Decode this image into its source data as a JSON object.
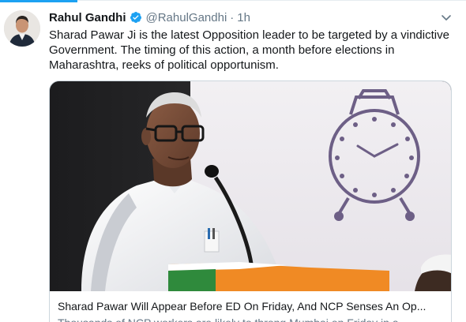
{
  "tweet": {
    "author_name": "Rahul Gandhi",
    "handle": "@RahulGandhi",
    "separator": "·",
    "time": "1h",
    "text": "Sharad Pawar Ji is the latest Opposition leader to be targeted by a vindictive Government. The timing of this action, a month before elections in Maharashtra, reeks of political opportunism."
  },
  "card": {
    "title": "Sharad Pawar Will Appear Before ED On Friday, And NCP Senses An Op...",
    "description": "Thousands of NCP workers are likely to throng Mumbai on Friday in a"
  },
  "icons": {
    "verified": "verified-badge-icon",
    "caret": "chevron-down-icon"
  },
  "colors": {
    "accent": "#1da1f2",
    "text": "#14171a",
    "secondary": "#657786",
    "border": "#ccd6dd"
  }
}
